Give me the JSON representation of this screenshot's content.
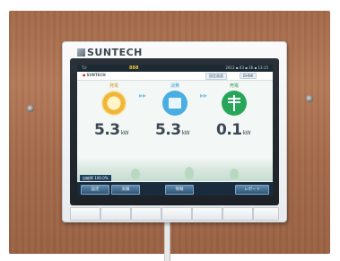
{
  "brand": "SUNTECH",
  "status_bar": {
    "signal": "T.ıl",
    "digits": "888",
    "datetime": "2012 ▪ 03 ▪ 16 ▪ 13:15"
  },
  "top_bar": {
    "brand_small": "SUNTECH",
    "tab1": "設定画面",
    "tab2": "BHNK"
  },
  "flows": [
    {
      "label": "発電",
      "value": "5.3",
      "unit": "kW",
      "icon": "sun-icon"
    },
    {
      "label": "消費",
      "value": "5.3",
      "unit": "kW",
      "icon": "house-icon"
    },
    {
      "label": "売電",
      "value": "0.1",
      "unit": "kW",
      "icon": "grid-icon"
    }
  ],
  "ratio": {
    "label": "自給率",
    "value": "100.0%"
  },
  "soft_buttons": [
    "設定",
    "実績",
    "情報",
    "レポート"
  ],
  "colors": {
    "generation": "#d89b2b",
    "consumption": "#41a3d8",
    "sell": "#3b9a58",
    "status_digits": "#f3c23a",
    "led": "#39d35a"
  }
}
